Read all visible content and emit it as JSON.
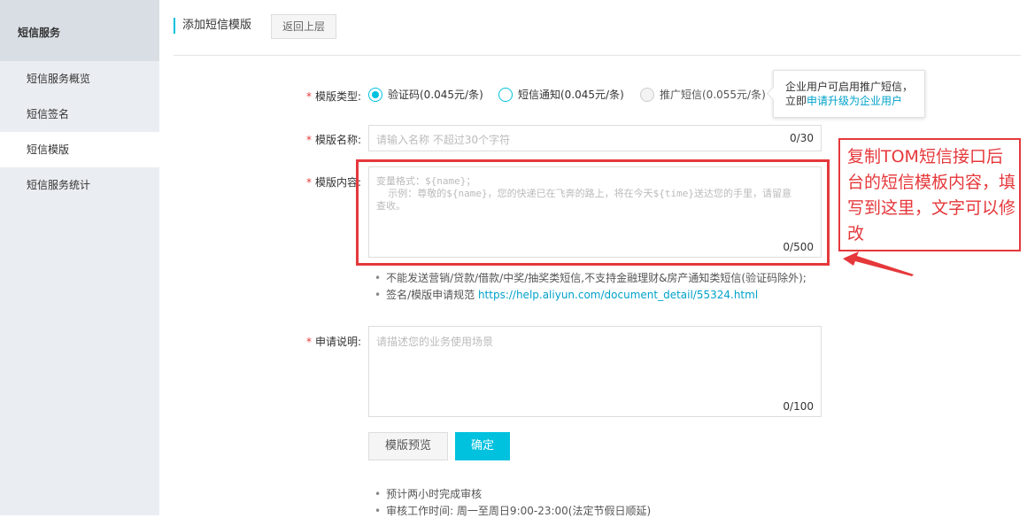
{
  "sidebar": {
    "title": "短信服务",
    "items": [
      {
        "label": "短信服务概览"
      },
      {
        "label": "短信签名"
      },
      {
        "label": "短信模版"
      },
      {
        "label": "短信服务统计"
      }
    ]
  },
  "header": {
    "title": "添加短信模版",
    "back_label": "返回上层"
  },
  "form": {
    "type": {
      "label": "模版类型:",
      "options": [
        {
          "label": "验证码(0.045元/条)",
          "checked": true
        },
        {
          "label": "短信通知(0.045元/条)",
          "checked": false
        },
        {
          "label": "推广短信(0.055元/条)",
          "checked": false,
          "disabled": true
        }
      ]
    },
    "tooltip": {
      "line1": "企业用户可启用推广短信，",
      "line2_prefix": "立即",
      "line2_link": "申请升级为企业用户"
    },
    "name": {
      "label": "模版名称:",
      "placeholder": "请输入名称 不超过30个字符",
      "counter": "0/30"
    },
    "content": {
      "label": "模版内容:",
      "placeholder_line1": "变量格式：${name}；",
      "placeholder_line2": "  示例：尊敬的${name}，您的快递已在飞奔的路上，将在今天${time}送达您的手里，请留意",
      "placeholder_line3": "查收。",
      "counter": "0/500"
    },
    "hints": {
      "line1": "不能发送营销/贷款/借款/中奖/抽奖类短信,不支持金融理财&房产通知类短信(验证码除外);",
      "line2_prefix": "签名/模版申请规范 ",
      "line2_url": "https://help.aliyun.com/document_detail/55324.html"
    },
    "desc": {
      "label": "申请说明:",
      "placeholder": "请描述您的业务使用场景",
      "counter": "0/100"
    },
    "buttons": {
      "preview": "模版预览",
      "confirm": "确定"
    },
    "notes": {
      "line1": "预计两小时完成审核",
      "line2": "审核工作时间: 周一至周日9:00-23:00(法定节假日顺延)"
    }
  },
  "annotation": {
    "text": "复制TOM短信接口后台的短信模板内容，填写到这里，文字可以修改",
    "color": "#e5383b"
  },
  "colors": {
    "accent": "#00c1de",
    "link": "#00a2ca",
    "required": "#e4393c"
  }
}
